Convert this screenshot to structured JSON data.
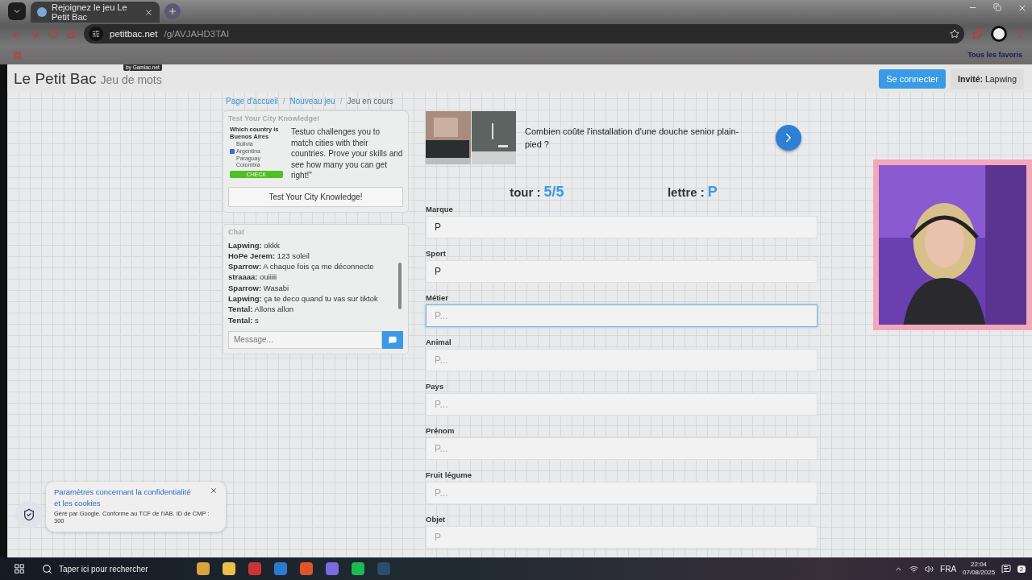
{
  "browser": {
    "tabs": [
      {
        "title": "Rejoignez le jeu Le Petit Bac",
        "selected": true
      }
    ],
    "url_host": "petitbac.net",
    "url_path": "/g/AVJAHD3TAI",
    "bookmarks_label": "Tous les favoris"
  },
  "header": {
    "title": "Le Petit Bac",
    "subtitle": "Jeu de mots",
    "badge": "by Gamiac.net",
    "login_button": "Se connecter",
    "guest": "**Invité:** Lapwing"
  },
  "breadcrumb_separator": "/",
  "breadcrumbs": [
    {
      "label": "Page d'accueil",
      "kind": "link"
    },
    {
      "label": "Nouveau jeu",
      "kind": "link"
    },
    {
      "label": "Jeu en cours",
      "kind": "current"
    }
  ],
  "ad_card": {
    "title": "Test Your City Knowledge!",
    "quiz_question": "Which country is Buenos Aires",
    "quiz_options": [
      {
        "label": "Bolivia",
        "checked": false
      },
      {
        "label": "Argentina",
        "checked": true
      },
      {
        "label": "Paraguay",
        "checked": false
      },
      {
        "label": "Colombia",
        "checked": false
      }
    ],
    "quiz_button": "CHECK",
    "text": "Testuo challenges you to match cities with their countries. Prove your skills and see how many you can get right!\"",
    "button": "Test Your City Knowledge!"
  },
  "chat": {
    "title": "Chat",
    "messages": [
      {
        "author": "Lapwing:",
        "text": "okkk"
      },
      {
        "author": "HoPe Jerem:",
        "text": "123 soleil"
      },
      {
        "author": "Sparrow:",
        "text": "A chaque fois ça me déconnecte"
      },
      {
        "author": "straaaa:",
        "text": "ouiiiii"
      },
      {
        "author": "Sparrow:",
        "text": "Wasabi"
      },
      {
        "author": "Lapwing:",
        "text": "ça te deco quand tu vas sur tiktok"
      },
      {
        "author": "Tental:",
        "text": "Allons allon"
      },
      {
        "author": "Tental:",
        "text": "s"
      }
    ],
    "input_placeholder": "Message..."
  },
  "promo": {
    "kind": "picture",
    "text": "Combien coûte l'installation d'une douche senior plain-pied ?"
  },
  "round": {
    "tour_label": "tour :",
    "tour_value": "5/5",
    "letter_label": "lettre :",
    "letter_value": "P"
  },
  "fields": [
    {
      "label": "Marque",
      "value": "P",
      "focused": false
    },
    {
      "label": "Sport",
      "value": "P",
      "focused": false
    },
    {
      "label": "Métier",
      "placeholder": "P...",
      "focused": true
    },
    {
      "label": "Animal",
      "placeholder": "P...",
      "focused": false
    },
    {
      "label": "Pays",
      "placeholder": "P...",
      "focused": false
    },
    {
      "label": "Prénom",
      "placeholder": "P...",
      "focused": false
    },
    {
      "label": "Fruit légume",
      "placeholder": "P...",
      "focused": false
    },
    {
      "label": "Objet",
      "placeholder": "P",
      "focused": false
    }
  ],
  "cookie_popup": {
    "title": "Paramètres concernant la confidentialité et les cookies",
    "text": "Géré par Google. Conforme au TCF de l'IAB. ID de CMP : 300"
  },
  "taskbar": {
    "search_placeholder": "Taper ici pour rechercher",
    "language": "FRA",
    "time": "22:04",
    "date": "07/08/2025",
    "notifications": "2"
  }
}
